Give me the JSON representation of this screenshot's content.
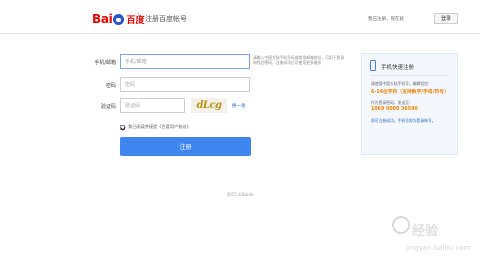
{
  "header": {
    "logo_bai": "Bai",
    "logo_du": "百度",
    "title": "注册百度帐号",
    "already_have_account": "我已注册，现在就",
    "login_label": "登录"
  },
  "form": {
    "phone_label": "手机/邮箱",
    "phone_placeholder": "手机/邮箱",
    "phone_hint": "请输入中国大陆手机号码或常用邮箱地址，可用于登录和找回密码，注册成功后可使用更多服务",
    "password_label": "密码",
    "password_placeholder": "密码",
    "captcha_label": "验证码",
    "captcha_placeholder": "验证码",
    "captcha_image_text": "dLcg",
    "refresh_label": "换一张",
    "agree_text": "我已阅读并接受《百度用户协议》",
    "register_label": "注册"
  },
  "side": {
    "title": "手机快速注册",
    "line1": "请使用中国大陆手机号，编辑短信：",
    "highlight1": "6-14位字符（支持数字/字母/符号）",
    "line2": "作为登录密码，发送至：",
    "highlight2": "1069 0000 36590",
    "line3": "即可注册成功，手机号即为登录帐号。"
  },
  "footer": {
    "copyright": "2015 ©Baidu"
  },
  "watermark": {
    "text": "经验",
    "url": "jingyan.baidu.com"
  },
  "colors": {
    "primary_button": "#3f86ef",
    "brand_red": "#e10602",
    "highlight_orange": "#e8840c",
    "link_blue": "#2b66c2"
  }
}
